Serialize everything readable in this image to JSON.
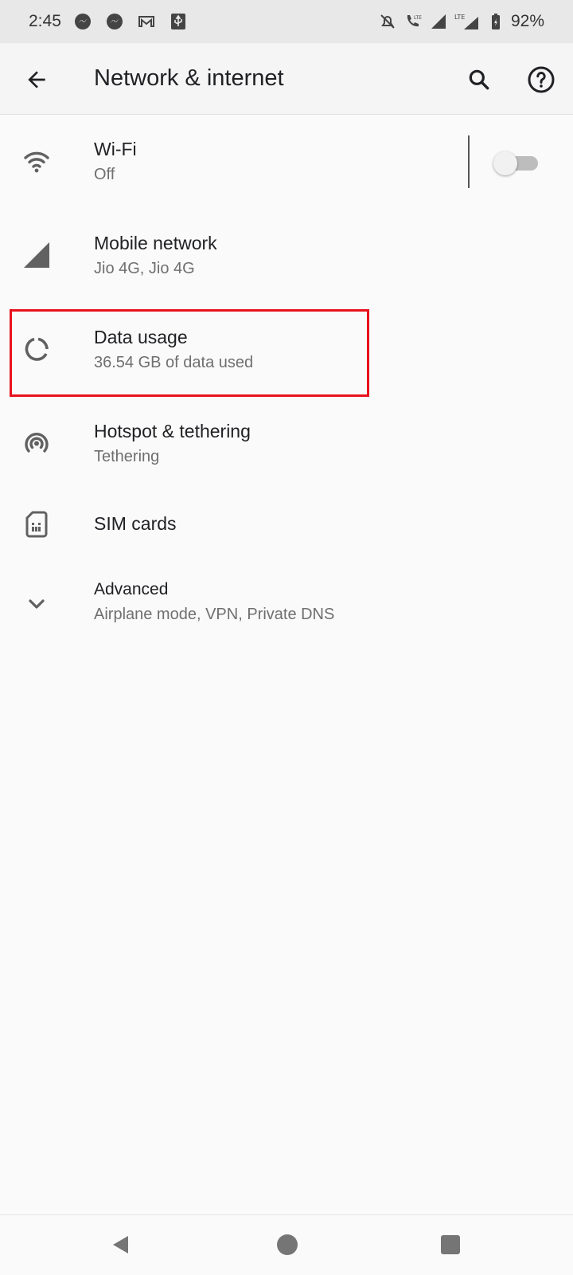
{
  "status_bar": {
    "time": "2:45",
    "battery": "92%",
    "left_icons": [
      "messenger-icon",
      "messenger-icon",
      "gmail-icon",
      "usb-icon"
    ],
    "right_icons": [
      "mute-icon",
      "volte-call-icon",
      "signal-icon",
      "lte-signal-icon",
      "battery-icon"
    ]
  },
  "app_bar": {
    "title": "Network & internet",
    "back_icon": "arrow-left-icon",
    "search_icon": "search-icon",
    "help_icon": "help-icon"
  },
  "settings": {
    "wifi": {
      "label": "Wi-Fi",
      "sub": "Off",
      "icon": "wifi-icon",
      "toggle_on": false
    },
    "mobile": {
      "label": "Mobile network",
      "sub": "Jio 4G, Jio 4G",
      "icon": "signal-icon"
    },
    "data_usage": {
      "label": "Data usage",
      "sub": "36.54 GB of data used",
      "icon": "data-usage-icon"
    },
    "hotspot": {
      "label": "Hotspot & tethering",
      "sub": "Tethering",
      "icon": "hotspot-icon"
    },
    "sim": {
      "label": "SIM cards",
      "icon": "sim-card-icon"
    },
    "advanced": {
      "label": "Advanced",
      "sub": "Airplane mode, VPN, Private DNS",
      "icon": "chevron-down-icon"
    }
  },
  "nav_bar": {
    "back": "nav-back-icon",
    "home": "nav-home-icon",
    "recents": "nav-recents-icon"
  },
  "colors": {
    "highlight": "#e8121c",
    "icon": "#616161",
    "background": "#fafafa"
  }
}
